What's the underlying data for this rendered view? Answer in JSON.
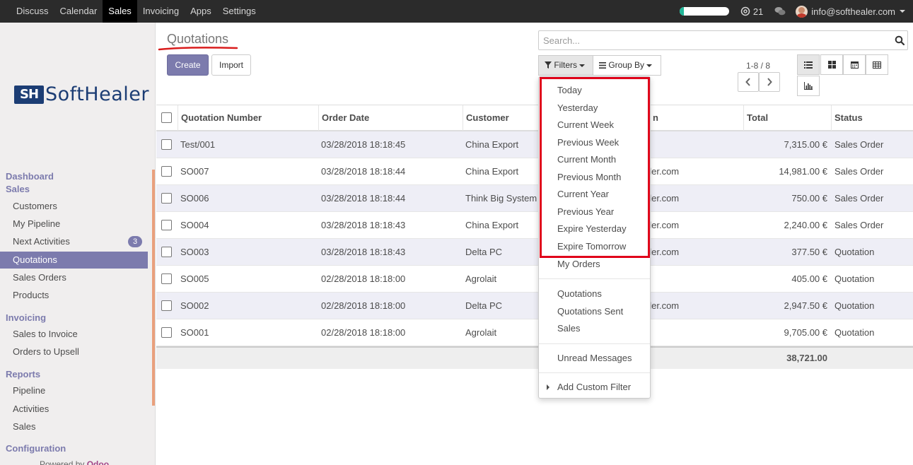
{
  "topbar": {
    "menu": [
      "Discuss",
      "Calendar",
      "Sales",
      "Invoicing",
      "Apps",
      "Settings"
    ],
    "active_menu": "Sales",
    "activity_count": "21",
    "user_email": "info@softhealer.com",
    "progress_fraction": 0.08
  },
  "sidebar": {
    "logo_mark": "SH",
    "logo_text": "SoftHealer",
    "sections": [
      {
        "label": "Dashboard"
      },
      {
        "label": "Sales",
        "items": [
          "Customers",
          "My Pipeline",
          "Next Activities",
          "Quotations",
          "Sales Orders",
          "Products"
        ]
      },
      {
        "label": "Invoicing",
        "items": [
          "Sales to Invoice",
          "Orders to Upsell"
        ]
      },
      {
        "label": "Reports",
        "items": [
          "Pipeline",
          "Activities",
          "Sales"
        ]
      },
      {
        "label": "Configuration"
      }
    ],
    "next_activities_count": "3",
    "active_item": "Quotations",
    "powered_by": "Powered by",
    "powered_brand": "Odoo"
  },
  "control_panel": {
    "title": "Quotations",
    "create_label": "Create",
    "import_label": "Import",
    "search_placeholder": "Search...",
    "filters_label": "Filters",
    "groupby_label": "Group By",
    "pager_text": "1-8 / 8"
  },
  "table": {
    "headers": [
      "Quotation Number",
      "Order Date",
      "Customer",
      "",
      "Total",
      "Status"
    ],
    "salesperson_header_fragment": "n",
    "rows": [
      {
        "number": "Test/001",
        "date": "03/28/2018 18:18:45",
        "customer": "China Export",
        "salesperson": "",
        "total": "7,315.00 €",
        "status": "Sales Order"
      },
      {
        "number": "SO007",
        "date": "03/28/2018 18:18:44",
        "customer": "China Export",
        "salesperson": "aler.com",
        "total": "14,981.00 €",
        "status": "Sales Order"
      },
      {
        "number": "SO006",
        "date": "03/28/2018 18:18:44",
        "customer": "Think Big System",
        "salesperson": "aler.com",
        "total": "750.00 €",
        "status": "Sales Order"
      },
      {
        "number": "SO004",
        "date": "03/28/2018 18:18:43",
        "customer": "China Export",
        "salesperson": "aler.com",
        "total": "2,240.00 €",
        "status": "Sales Order"
      },
      {
        "number": "SO003",
        "date": "03/28/2018 18:18:43",
        "customer": "Delta PC",
        "salesperson": "aler.com",
        "total": "377.50 €",
        "status": "Quotation"
      },
      {
        "number": "SO005",
        "date": "02/28/2018 18:18:00",
        "customer": "Agrolait",
        "salesperson": "",
        "total": "405.00 €",
        "status": "Quotation"
      },
      {
        "number": "SO002",
        "date": "02/28/2018 18:18:00",
        "customer": "Delta PC",
        "salesperson": "aler.com",
        "total": "2,947.50 €",
        "status": "Quotation"
      },
      {
        "number": "SO001",
        "date": "02/28/2018 18:18:00",
        "customer": "Agrolait",
        "salesperson": "",
        "total": "9,705.00 €",
        "status": "Quotation"
      }
    ],
    "grand_total": "38,721.00"
  },
  "filters_dropdown": {
    "date_filters": [
      "Today",
      "Yesterday",
      "Current Week",
      "Previous Week",
      "Current Month",
      "Previous Month",
      "Current Year",
      "Previous Year",
      "Expire Yesterday",
      "Expire Tomorrow"
    ],
    "my_orders": "My Orders",
    "state_filters": [
      "Quotations",
      "Quotations Sent",
      "Sales"
    ],
    "unread": "Unread Messages",
    "custom": "Add Custom Filter"
  },
  "colors": {
    "brand": "#7c7bad",
    "topbar": "#2b2b2b",
    "highlight": "#e0001a",
    "logo": "#1c3d74"
  }
}
